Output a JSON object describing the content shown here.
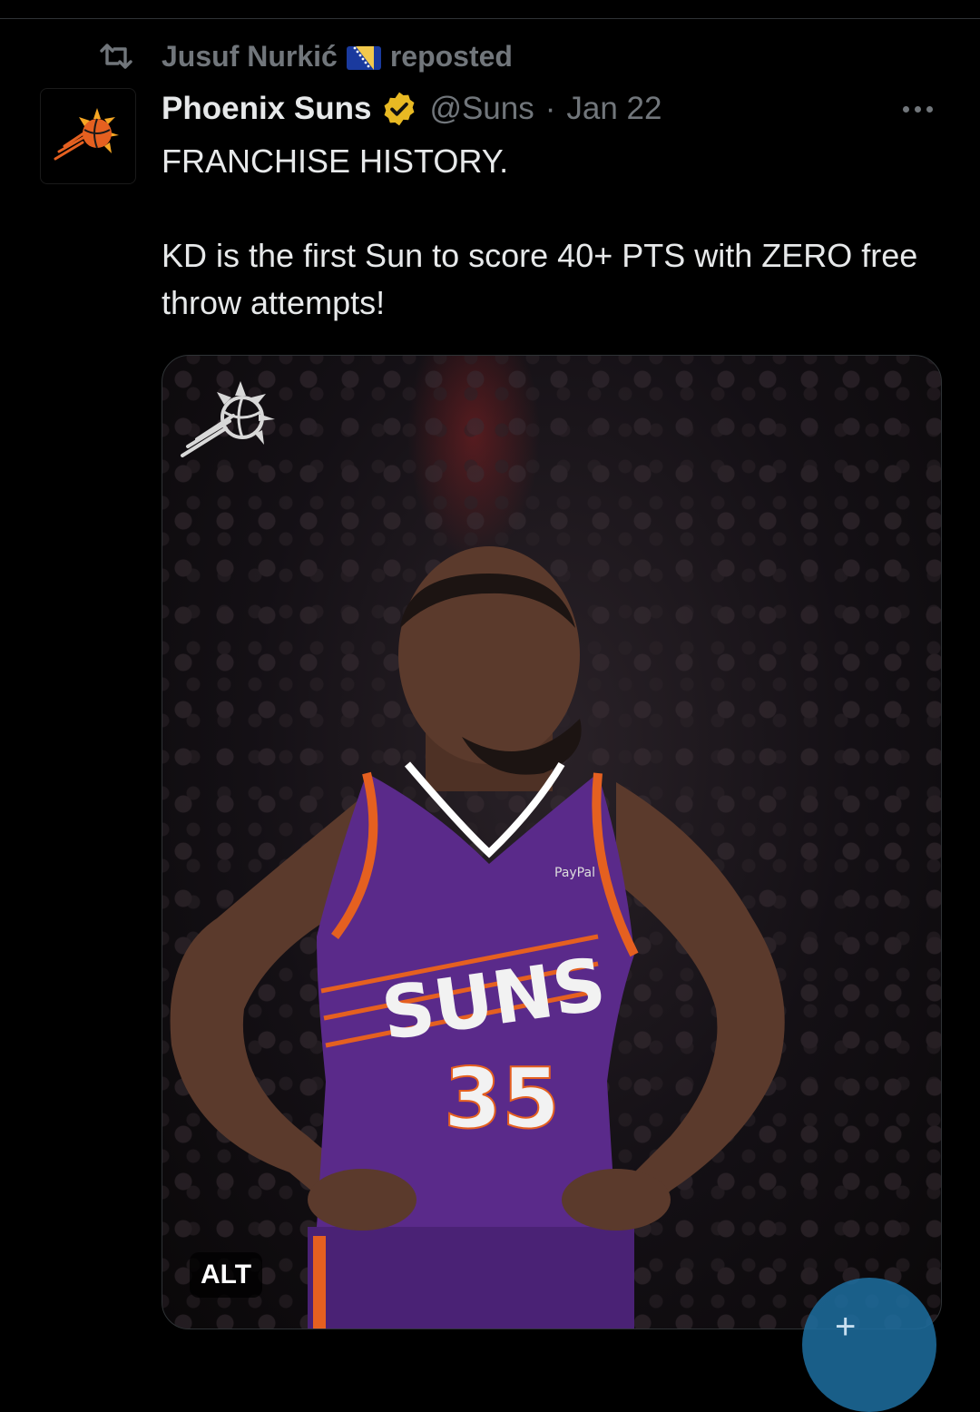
{
  "repost": {
    "icon": "repost-icon",
    "user_name": "Jusuf Nurkić",
    "flag": "bosnia-herzegovina-flag",
    "label": "reposted"
  },
  "tweet": {
    "avatar": "phoenix-suns-logo",
    "display_name": "Phoenix Suns",
    "verified": "verified-gold-badge",
    "handle": "@Suns",
    "separator": "·",
    "date": "Jan 22",
    "more_icon": "more-dots-icon",
    "text_line1": "FRANCHISE HISTORY.",
    "text_line2": "KD is the first Sun to score 40+ PTS with ZERO free throw attempts!"
  },
  "media": {
    "logo": "suns-sunburst-logo",
    "jersey_text": "SUNS",
    "jersey_number": "35",
    "sponsor": "PayPal",
    "alt_label": "ALT"
  },
  "fab": {
    "icon": "compose-post-icon",
    "label": "+"
  },
  "colors": {
    "background": "#000000",
    "text": "#e7e9ea",
    "muted": "#71767b",
    "verified_gold": "#e8b923",
    "suns_purple": "#5a2a8a",
    "suns_orange": "#e56020",
    "fab_blue": "#1d6ea0"
  }
}
